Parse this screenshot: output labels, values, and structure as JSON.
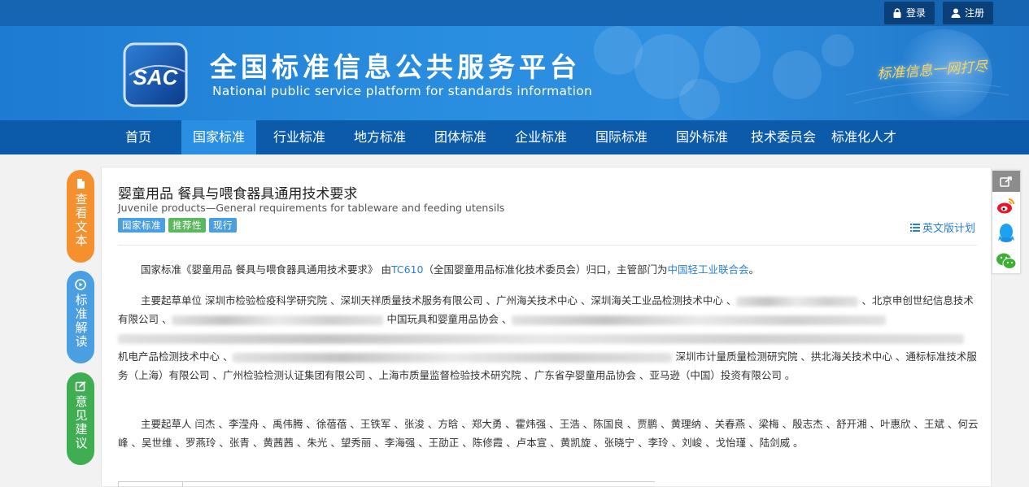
{
  "topbar": {
    "login": "登录",
    "register": "注册"
  },
  "header": {
    "logo_text": "SAC",
    "title": "全国标准信息公共服务平台",
    "subtitle": "National public service platform  for standards information",
    "slogan": "标准信息一网打尽"
  },
  "nav": [
    "首页",
    "国家标准",
    "行业标准",
    "地方标准",
    "团体标准",
    "企业标准",
    "国际标准",
    "国外标准",
    "技术委员会",
    "标准化人才"
  ],
  "side_actions": {
    "view_text": "查看文本",
    "interpret": "标准解读",
    "feedback": "意见建议"
  },
  "standard": {
    "title": "婴童用品 餐具与喂食器具通用技术要求",
    "title_en": "Juvenile products—General requirements for tableware and feeding utensils",
    "tags": [
      "国家标准",
      "推荐性",
      "现行"
    ],
    "en_plan": "英文版计划",
    "intro_prefix": "国家标准《婴童用品 餐具与喂食器具通用技术要求》 由",
    "tc_code": "TC610",
    "intro_middle": "（全国婴童用品标准化技术委员会）归口，主管部门为",
    "authority": "中国轻工业联合会",
    "intro_suffix": "。",
    "drafting_units_label": "主要起草单位",
    "drafting_units_part1": "深圳市检验检疫科学研究院 、深圳天祥质量技术服务有限公司 、广州海关技术中心 、深圳海关工业品检测技术中心 、",
    "drafting_units_part2": " 、北京申创世纪信息技术有限公司 、",
    "drafting_units_part3": " 中国玩具和婴童用品协会 、",
    "drafting_units_part4": "机电产品检测技术中心 、",
    "drafting_units_part5": " 深圳市计量质量检测研究院 、拱北海关技术中心 、通标标准技术服务（上海）有限公司 、广州检验检测认证集团有限公司 、上海市质量监督检验技术研究院 、广东省孕婴童用品协会 、亚马逊（中国）投资有限公司 。",
    "drafters_label": "主要起草人",
    "drafters": "闫杰 、李滢舟 、禹伟腾 、徐蓓蓓 、王铁军 、张浚 、方晗 、郑大勇 、霍炜强 、王浩 、陈国良 、贾鹏 、黄理纳 、关春燕 、梁梅 、殷志杰 、舒开湘 、叶惠欣 、王斌 、何云峰 、吴世维 、罗燕玲 、张青 、黄茜茜 、朱光 、望秀丽 、李海强 、王劭正 、陈修霞 、卢本宣 、黄凯旋 、张晓宁 、李玲 、刘峻 、戈怡瑾 、陆剑威 。"
  }
}
